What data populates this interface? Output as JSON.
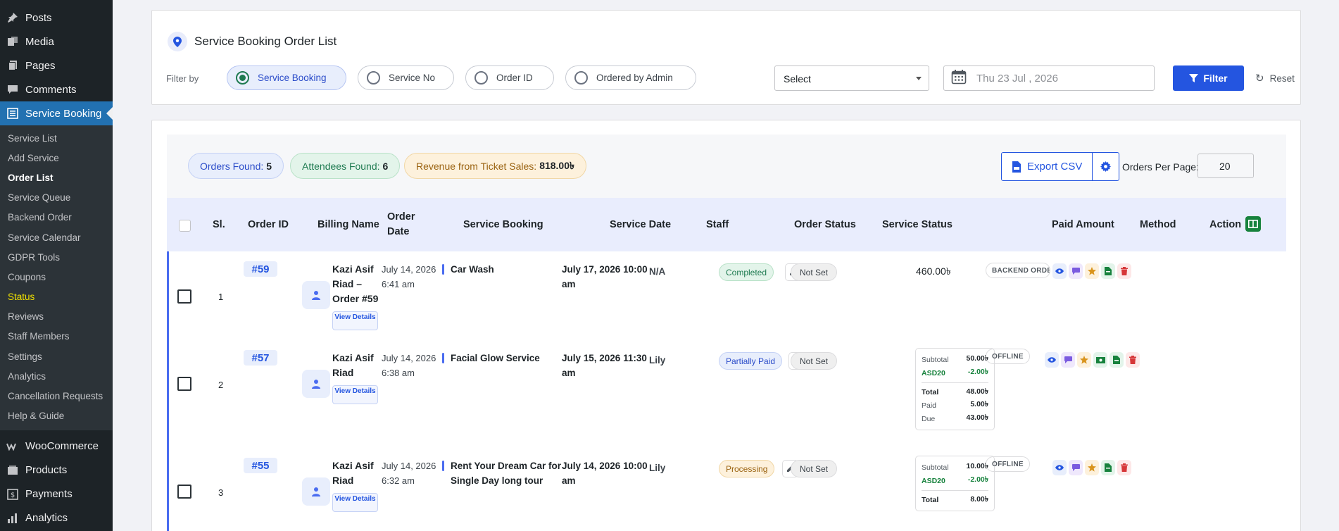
{
  "sidebar": {
    "top_items": [
      {
        "label": "Posts",
        "icon": "pushpin-icon"
      },
      {
        "label": "Media",
        "icon": "media-icon"
      },
      {
        "label": "Pages",
        "icon": "pages-icon"
      },
      {
        "label": "Comments",
        "icon": "comment-icon"
      },
      {
        "label": "Service Booking",
        "icon": "list-icon",
        "active": true
      }
    ],
    "sub_items": [
      "Service List",
      "Add Service",
      "Order List",
      "Service Queue",
      "Backend Order",
      "Service Calendar",
      "GDPR Tools",
      "Coupons",
      "Status",
      "Reviews",
      "Staff Members",
      "Settings",
      "Analytics",
      "Cancellation Requests",
      "Help & Guide"
    ],
    "bottom_items": [
      {
        "label": "WooCommerce",
        "icon": "woo-icon"
      },
      {
        "label": "Products",
        "icon": "products-icon"
      },
      {
        "label": "Payments",
        "icon": "payments-icon"
      },
      {
        "label": "Analytics",
        "icon": "analytics-icon"
      }
    ]
  },
  "filter_panel": {
    "title": "Service Booking Order List",
    "filter_label": "Filter by",
    "options": [
      "Service Booking",
      "Service No",
      "Order ID",
      "Ordered by Admin"
    ],
    "selected_option": "Service Booking",
    "select_value": "Select",
    "date_value": "Thu 23 Jul , 2026",
    "filter_button": "Filter",
    "reset_button": "Reset"
  },
  "stats": {
    "orders_label": "Orders Found:",
    "orders_value": "5",
    "attendees_label": "Attendees Found:",
    "attendees_value": "6",
    "revenue_label": "Revenue from Ticket Sales:",
    "revenue_value": "818.00৳"
  },
  "toolbar": {
    "export_label": "Export CSV",
    "per_page_label": "Orders Per Page:",
    "per_page_value": "20"
  },
  "table": {
    "headers": {
      "sl": "Sl.",
      "order_id": "Order ID",
      "billing_name": "Billing Name",
      "order_date": "Order Date",
      "service_booking": "Service Booking",
      "service_date": "Service Date",
      "staff": "Staff",
      "order_status": "Order Status",
      "service_status": "Service Status",
      "paid_amount": "Paid Amount",
      "method": "Method",
      "action": "Action"
    },
    "view_details": "View Details",
    "rows": [
      {
        "sl": "1",
        "order_id": "#59",
        "billing_name": "Kazi Asif Riad – Order #59",
        "order_date": "July 14, 2026 6:41 am",
        "service": "Car Wash",
        "service_date": "July 17, 2026 10:00 am",
        "staff": "N/A",
        "order_status": "Completed",
        "service_status": "Not Set",
        "paid": "460.00৳",
        "method": "BACKEND ORDER"
      },
      {
        "sl": "2",
        "order_id": "#57",
        "billing_name": "Kazi Asif Riad",
        "order_date": "July 14, 2026 6:38 am",
        "service": "Facial Glow Service",
        "service_date": "July 15, 2026 11:30 am",
        "staff": "Lily",
        "order_status": "Partially Paid",
        "service_status": "Not Set",
        "paid_breakdown": {
          "subtotal_label": "Subtotal",
          "subtotal": "50.00৳",
          "coupon_label": "ASD20",
          "coupon": "-2.00৳",
          "total_label": "Total",
          "total": "48.00৳",
          "paid_label": "Paid",
          "paid": "5.00৳",
          "due_label": "Due",
          "due": "43.00৳"
        },
        "method": "OFFLINE"
      },
      {
        "sl": "3",
        "order_id": "#55",
        "billing_name": "Kazi Asif Riad",
        "order_date": "July 14, 2026 6:32 am",
        "service": "Rent Your Dream Car for Single Day long tour",
        "service_date": "July 14, 2026 10:00 am",
        "staff": "Lily",
        "order_status": "Processing",
        "service_status": "Not Set",
        "paid_breakdown": {
          "subtotal_label": "Subtotal",
          "subtotal": "10.00৳",
          "coupon_label": "ASD20",
          "coupon": "-2.00৳",
          "total_label": "Total",
          "total": "8.00৳"
        },
        "method": "OFFLINE"
      }
    ]
  },
  "colors": {
    "sidebar_bg": "#1d2327",
    "active_menu": "#2271b1",
    "primary": "#2455e0",
    "success": "#1e7a50",
    "warning": "#9a6210"
  }
}
